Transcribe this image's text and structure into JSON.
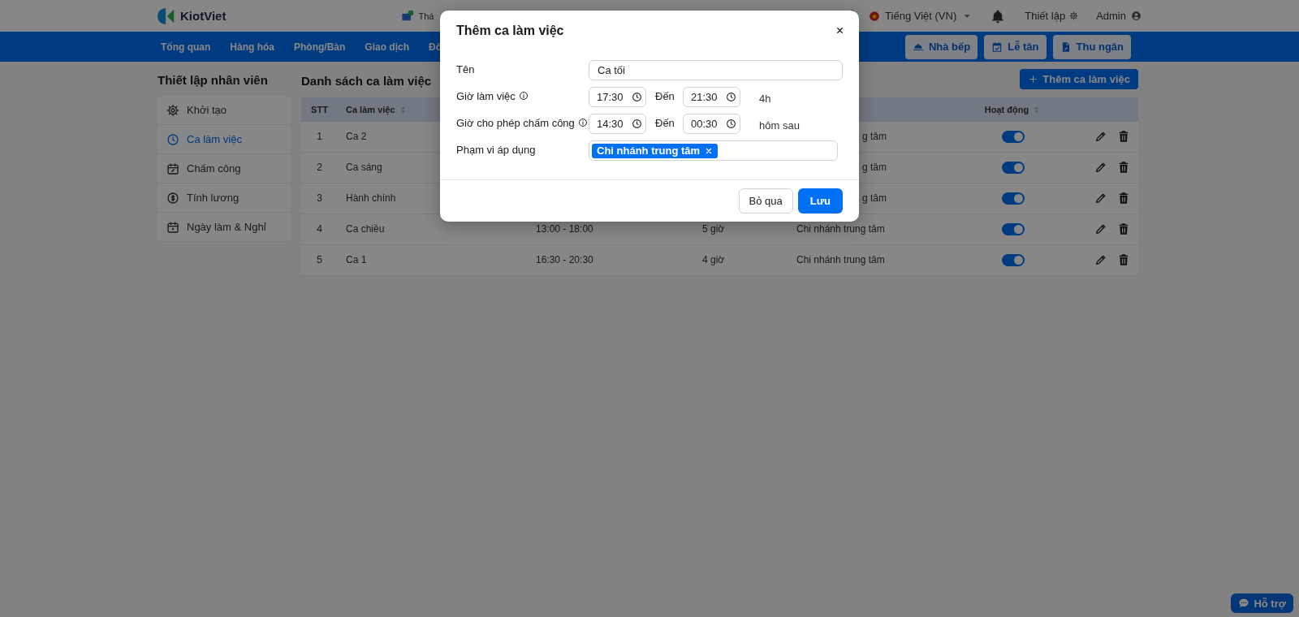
{
  "header": {
    "logo": "KiotViet",
    "cut_link": "Thá",
    "language": "Tiếng Việt (VN)",
    "settings": "Thiết lập",
    "user": "Admin"
  },
  "nav": {
    "items": [
      "Tổng quan",
      "Hàng hóa",
      "Phòng/Bàn",
      "Giao dịch",
      "Đố"
    ],
    "buttons": [
      "Nhà bếp",
      "Lễ tân",
      "Thu ngân"
    ]
  },
  "sidebar": {
    "title": "Thiết lập nhân viên",
    "items": [
      {
        "label": "Khởi tạo",
        "selected": false
      },
      {
        "label": "Ca làm việc",
        "selected": true
      },
      {
        "label": "Chấm công",
        "selected": false
      },
      {
        "label": "Tính lương",
        "selected": false
      },
      {
        "label": "Ngày làm & Nghỉ",
        "selected": false
      }
    ]
  },
  "main": {
    "title": "Danh sách ca làm việc",
    "add_button": "Thêm ca làm việc",
    "table": {
      "columns": [
        {
          "label": "STT",
          "sortable": false
        },
        {
          "label": "Ca làm việc",
          "sortable": true
        },
        {
          "label": "Hoạt động",
          "sortable": true
        }
      ],
      "rows": [
        {
          "stt": "1",
          "name": "Ca 2",
          "branch": "g tâm",
          "partly_hidden": true,
          "active": true
        },
        {
          "stt": "2",
          "name": "Ca sáng",
          "branch": "g tâm",
          "partly_hidden": true,
          "active": true
        },
        {
          "stt": "3",
          "name": "Hành chính",
          "branch": "g tâm",
          "partly_hidden": true,
          "active": true
        },
        {
          "stt": "4",
          "name": "Ca chiều",
          "time": "13:00 - 18:00",
          "hours": "5 giờ",
          "branch": "Chi nhánh trung tâm",
          "partly_hidden": false,
          "active": true
        },
        {
          "stt": "5",
          "name": "Ca 1",
          "time": "16:30 - 20:30",
          "hours": "4 giờ",
          "branch": "Chi nhánh trung tâm",
          "partly_hidden": false,
          "active": true
        }
      ]
    }
  },
  "dialog": {
    "title": "Thêm ca làm việc",
    "fields": [
      {
        "kind": "text",
        "label": "Tên",
        "value": "Ca tối"
      },
      {
        "kind": "time-range",
        "label": "Giờ làm việc",
        "info": true,
        "from": "17:30",
        "to_label": "Đến",
        "to": "21:30",
        "note": "4h"
      },
      {
        "kind": "time-range",
        "label": "Giờ cho phép chấm công",
        "info": true,
        "from": "14:30",
        "to_label": "Đến",
        "to": "00:30",
        "note": "hôm sau"
      },
      {
        "kind": "tags",
        "label": "Phạm vi áp dụng",
        "tags": [
          "Chi nhánh trung tâm"
        ]
      }
    ],
    "buttons": [
      {
        "label": "Bỏ qua",
        "kind": "secondary"
      },
      {
        "label": "Lưu",
        "kind": "primary"
      }
    ]
  },
  "help_button": "Hỗ trợ"
}
